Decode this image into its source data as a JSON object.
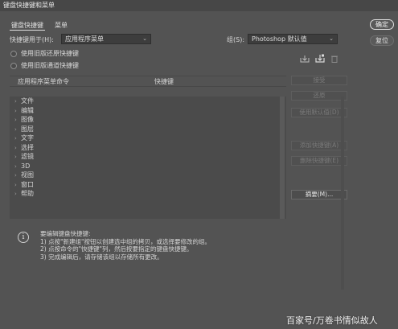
{
  "window": {
    "title": "键盘快捷键和菜单"
  },
  "tabs": [
    {
      "label": "键盘快捷键"
    },
    {
      "label": "菜单"
    }
  ],
  "shortcuts_for": {
    "label": "快捷键用于(H):",
    "value": "应用程序菜单"
  },
  "set": {
    "label": "组(S):",
    "value": "Photoshop 默认值"
  },
  "options": {
    "legacy_undo": "使用旧版还原快捷键",
    "legacy_channel": "使用旧版通道快捷键"
  },
  "table": {
    "col_command": "应用程序菜单命令",
    "col_shortcut": "快捷键",
    "items": [
      "文件",
      "编辑",
      "图像",
      "图层",
      "文字",
      "选择",
      "滤镜",
      "3D",
      "视图",
      "窗口",
      "帮助"
    ]
  },
  "side_buttons": {
    "accept": "接受",
    "undo": "还原",
    "use_default": "使用默认值(D)",
    "add_shortcut": "添加快捷键(A)",
    "delete_shortcut": "删除快捷键(E)",
    "summarize": "摘要(M)..."
  },
  "dialog_buttons": {
    "ok": "确定",
    "reset": "复位"
  },
  "info": {
    "line1": "要编辑键盘快捷键:",
    "line2": "1) 点按\"新建组\"按钮以创建选中组的拷贝，或选择要修改的组。",
    "line3": "2) 点按命令的\"快捷键\"列，然后按要指定的键盘快捷键。",
    "line4": "3) 完成编辑后，请存储该组以存储所有更改。"
  },
  "watermark": "百家号/万卷书情似故人"
}
